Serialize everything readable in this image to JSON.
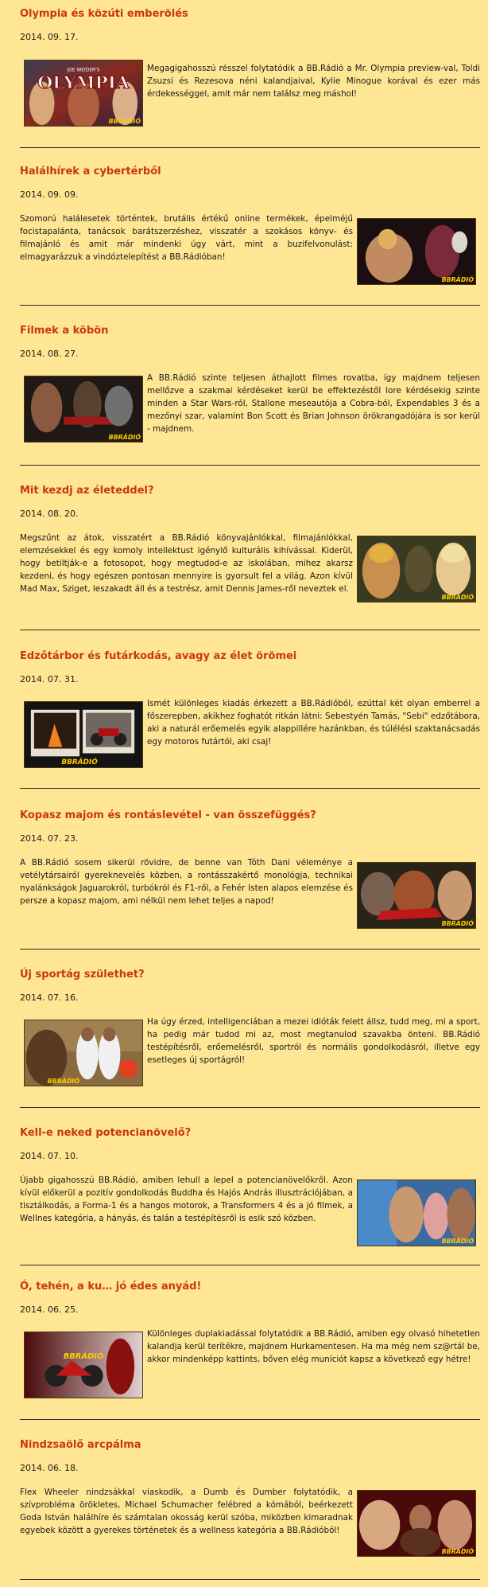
{
  "posts": [
    {
      "title": "Olympia és közúti emberölés",
      "date": "2014. 09. 17.",
      "body": "Megagigahosszú résszel folytatódik a BB.Rádió a Mr. Olympia preview-val, Toldi Zsuzsi és Rezesova néni kalandjaival, Kylie Minogue korával és ezer más érdekességgel, amit már nem találsz meg máshol!",
      "image_text": "OLYMPIA",
      "image_subtext": "JOE WEIDER'S",
      "logo": "BBRÁDIÓ"
    },
    {
      "title": "Halálhírek a cybertérből",
      "date": "2014. 09. 09.",
      "body": "Szomorú halálesetek történtek, brutális értékű online termékek, épelméjű focistapalánta, tanácsok barátszerzéshez, visszatér a szokásos könyv- és filmajánló és amit már mindenki úgy várt, mint a buzifelvonulást: elmagyarázzuk a vindóztelepítést a BB.Rádióban!",
      "logo": "BBRÁDIÓ"
    },
    {
      "title": "Filmek a köbön",
      "date": "2014. 08. 27.",
      "body": "A BB.Rádió szinte teljesen áthajlott filmes rovatba, így majdnem teljesen mellőzve a szakmai kérdéseket kerül be effektezéstől lore kérdésekig szinte minden a Star Wars-ról, Stallone meseautója a Cobra-ból, Expendables 3 és a mezőnyi szar, valamint Bon Scott és Brian Johnson örökrangadójára is sor kerül - majdnem.",
      "logo": "BBRÁDIÓ"
    },
    {
      "title": "Mit kezdj az életeddel?",
      "date": "2014. 08. 20.",
      "body": "Megszűnt az átok, visszatért a BB.Rádió könyvajánlókkal, filmajánlókkal, elemzésekkel és egy komoly intellektust igénylő kulturális kihívással. Kiderül, hogy betiltják-e a fotosopot, hogy megtudod-e az iskolában, mihez akarsz kezdeni, és hogy egészen pontosan mennyire is gyorsult fel a világ. Azon kívül Mad Max, Sziget, leszakadt áll és a testrész, amit Dennis James-ről neveztek el.",
      "logo": "BBRÁDIÓ"
    },
    {
      "title": "Edzőtárbor és futárkodás, avagy az élet örömei",
      "date": "2014. 07. 31.",
      "body": "Ismét különleges kiadás érkezett a BB.Rádióból, ezúttal két olyan emberrel a főszerepben, akikhez foghatót ritkán látni: Sebestyén Tamás, \"Sebi\" edzőtábora, aki a naturál erőemelés egyik alappillére hazánkban, és túlélési szaktanácsadás egy motoros futártól, aki csaj!",
      "logo": "BBRÁDIÓ"
    },
    {
      "title": "Kopasz majom és rontáslevétel - van összefüggés?",
      "date": "2014. 07. 23.",
      "body": "A BB.Rádió sosem sikerül rövidre, de benne van Tóth Dani véleménye a vetélytársairól gyereknevelés közben, a rontásszakértő monológja, technikai nyalánkságok Jaguarokról, turbókról és F1-ről, a Fehér Isten alapos elemzése és persze a kopasz majom, ami nélkül nem lehet teljes a napod!",
      "logo": "BBRÁDIÓ"
    },
    {
      "title": "Új sportág születhet?",
      "date": "2014. 07. 16.",
      "body": "Ha úgy érzed, intelligenciában a mezei idióták felett állsz, tudd meg, mi a sport, ha pedig már tudod mi az, most megtanulod szavakba önteni. BB.Rádió testépítésről, erőemelésről, sportról és normális gondolkodásról, illetve egy esetleges új sportágról!",
      "logo": "BBRÁDIÓ"
    },
    {
      "title": "Kell-e neked potencianövelő?",
      "date": "2014. 07. 10.",
      "body": "Újabb gigahosszú BB.Rádió, amiben lehull a lepel a potencianövelőkről. Azon kívül előkerül a pozitív gondolkodás Buddha és Hajós András illusztrációjában, a tisztálkodás, a Forma-1 és a hangos motorok, a Transformers 4 és a jó filmek, a Wellnes kategória, a hányás, és talán a testépítésről is esik szó közben.",
      "logo": "BBRÁDIÓ"
    },
    {
      "title": "Ó, tehén, a ku… jó édes anyád!",
      "date": "2014. 06. 25.",
      "body": "Különleges duplakiadással folytatódik a BB.Rádió, amiben egy olvasó hihetetlen kalandja kerül terítékre, majdnem Hurkamentesen. Ha ma még nem sz@rtál be, akkor mindenképp kattints, bőven elég muníciót kapsz a következő egy hétre!",
      "logo": "BBRÁDIÓ"
    },
    {
      "title": "Nindzsaölő arcpálma",
      "date": "2014. 06. 18.",
      "body": "Flex Wheeler nindzsákkal viaskodik, a Dumb és Dumber folytatódik, a szívprobléma örökletes, Michael Schumacher felébred a kómából, beérkezett Goda István halálhíre és számtalan okosság kerül szóba, miközben kimaradnak egyebek között a gyerekes történetek és a wellness kategória a BB.Rádióból!",
      "logo": "BBRÁDIÓ"
    }
  ]
}
